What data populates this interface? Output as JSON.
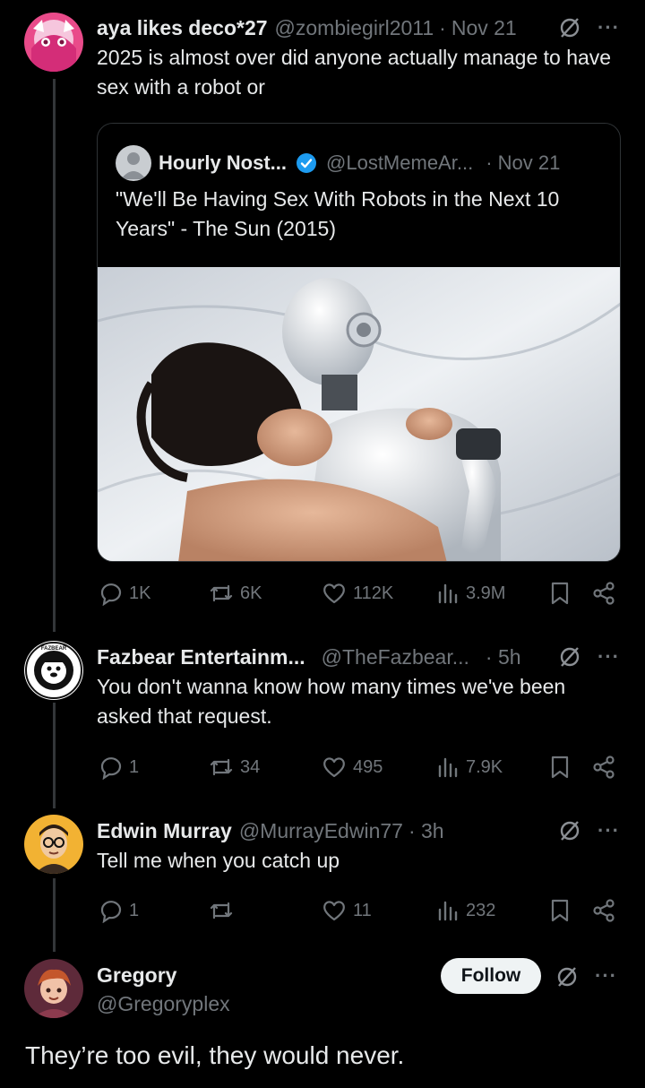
{
  "posts": [
    {
      "name": "aya likes deco*27",
      "handle": "@zombiegirl2011",
      "time": "Nov 21",
      "text": "2025 is almost over did anyone actually manage to have sex with a robot or",
      "quote": {
        "name": "Hourly Nost...",
        "handle": "@LostMemeAr...",
        "time": "· Nov 21",
        "text": "\"We'll Be Having Sex With Robots in the Next 10 Years\" - The Sun (2015)"
      },
      "stats": {
        "replies": "1K",
        "reposts": "6K",
        "likes": "112K",
        "views": "3.9M"
      }
    },
    {
      "name": "Fazbear Entertainm...",
      "handle": "@TheFazbear...",
      "time": "· 5h",
      "text": "You don't wanna know how many times we've been asked that request.",
      "stats": {
        "replies": "1",
        "reposts": "34",
        "likes": "495",
        "views": "7.9K"
      }
    },
    {
      "name": "Edwin Murray",
      "handle": "@MurrayEdwin77",
      "time": "· 3h",
      "text": "Tell me when you catch up",
      "stats": {
        "replies": "1",
        "reposts": "",
        "likes": "11",
        "views": "232"
      }
    },
    {
      "name": "Gregory",
      "handle": "@Gregoryplex",
      "follow_label": "Follow",
      "text": "They’re too evil, they would never."
    }
  ],
  "separator": "·",
  "colors": {
    "background": "#000000",
    "text": "#e7e9ea",
    "muted": "#71767b",
    "verified": "#1d9bf0",
    "line": "#333639"
  },
  "icons": [
    "reply-icon",
    "repost-icon",
    "like-icon",
    "views-icon",
    "bookmark-icon",
    "share-icon",
    "grok-icon",
    "more-icon",
    "verified-icon"
  ]
}
